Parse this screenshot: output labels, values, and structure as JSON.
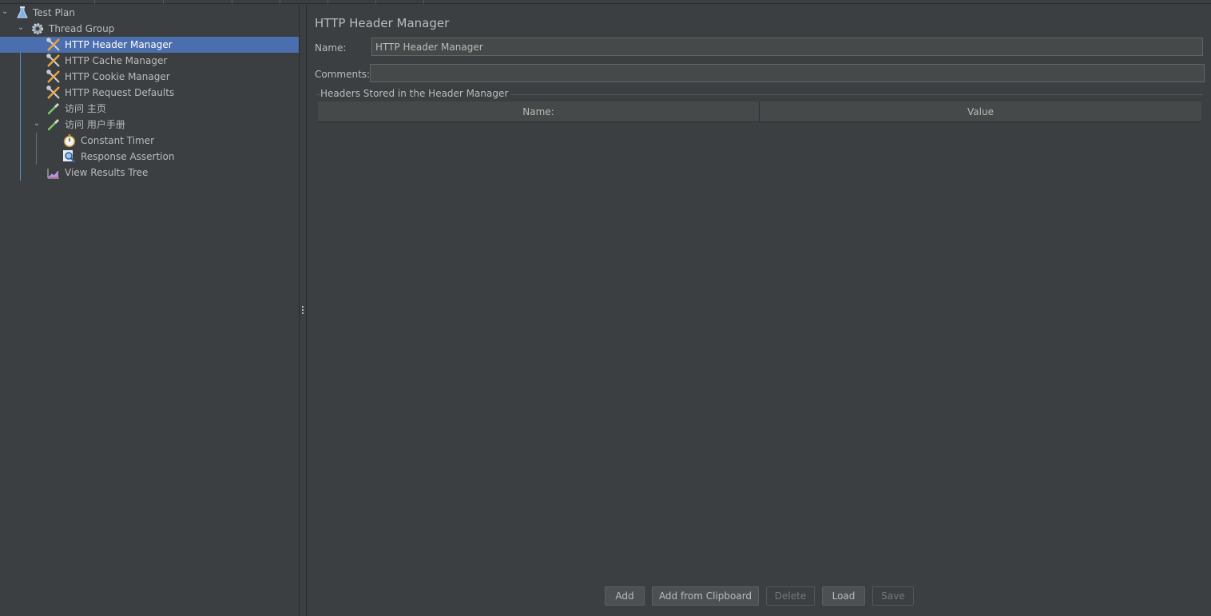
{
  "tree": {
    "items": [
      {
        "label": "Test Plan",
        "icon": "flask-icon",
        "expanded": true
      },
      {
        "label": "Thread Group",
        "icon": "gear-icon",
        "expanded": true
      },
      {
        "label": "HTTP Header Manager",
        "icon": "wrench-screwdriver-icon",
        "selected": true
      },
      {
        "label": "HTTP Cache Manager",
        "icon": "wrench-screwdriver-icon"
      },
      {
        "label": "HTTP Cookie Manager",
        "icon": "wrench-screwdriver-icon"
      },
      {
        "label": "HTTP Request Defaults",
        "icon": "wrench-screwdriver-icon"
      },
      {
        "label": "访问 主页",
        "icon": "pipette-icon"
      },
      {
        "label": "访问 用户手册",
        "icon": "pipette-icon",
        "expanded": true
      },
      {
        "label": "Constant Timer",
        "icon": "stopwatch-icon"
      },
      {
        "label": "Response Assertion",
        "icon": "magnifier-icon"
      },
      {
        "label": "View Results Tree",
        "icon": "chart-icon"
      }
    ]
  },
  "panel": {
    "title": "HTTP Header Manager",
    "name_label": "Name:",
    "name_value": "HTTP Header Manager",
    "comments_label": "Comments:",
    "comments_value": "",
    "group_title": "Headers Stored in the Header Manager",
    "table": {
      "columns": [
        "Name:",
        "Value"
      ],
      "rows": []
    }
  },
  "buttons": {
    "add": "Add",
    "add_from_clipboard": "Add from Clipboard",
    "delete": "Delete",
    "load": "Load",
    "save": "Save"
  },
  "colors": {
    "background": "#3c3f41",
    "selection": "#4b6eaf",
    "text": "#bbbbbb",
    "field": "#45494a"
  }
}
